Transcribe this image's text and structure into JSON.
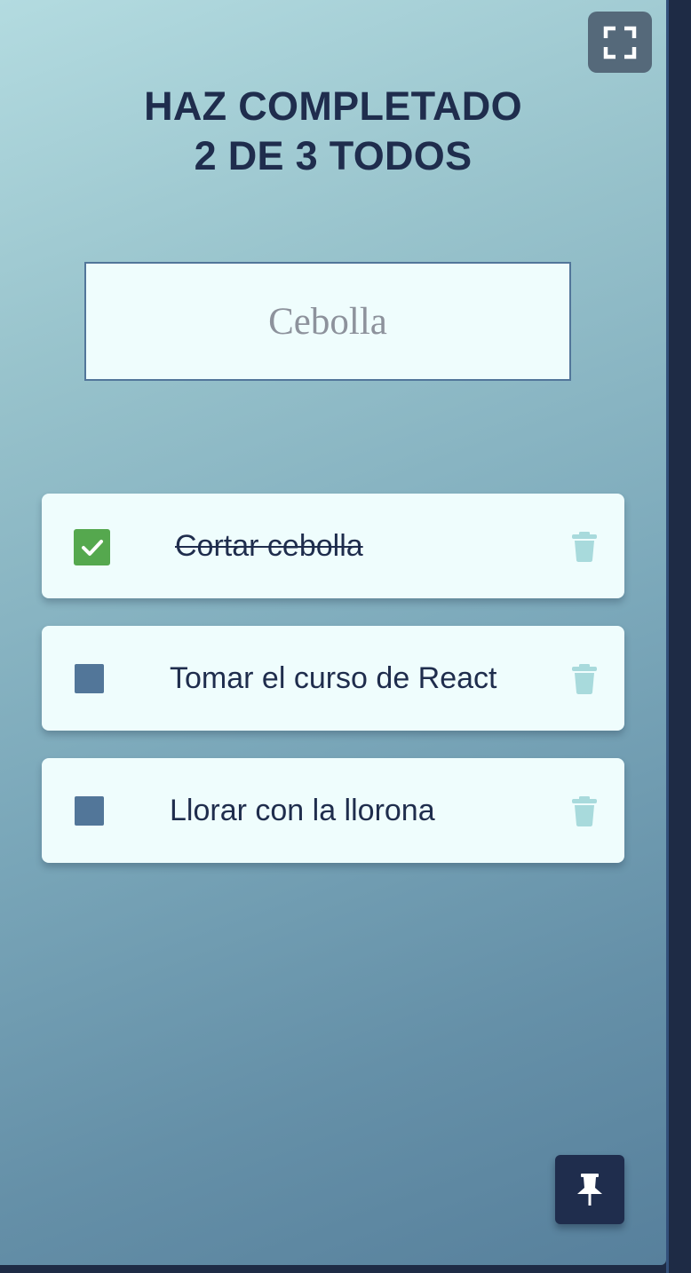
{
  "header": {
    "title_line1": "HAZ COMPLETADO",
    "title_line2": "2 DE 3 TODOS",
    "completed_count": 2,
    "total_count": 3
  },
  "search": {
    "placeholder": "Cebolla",
    "value": ""
  },
  "todos": [
    {
      "text": "Cortar cebolla",
      "completed": true
    },
    {
      "text": "Tomar el curso de React",
      "completed": false
    },
    {
      "text": "Llorar con la llorona",
      "completed": false
    }
  ],
  "icons": {
    "fullscreen": "fullscreen-icon",
    "check": "check-icon",
    "delete": "trash-icon",
    "pin": "pin-icon"
  },
  "colors": {
    "title_text": "#1f2d4d",
    "checkbox_unchecked": "#527699",
    "checkbox_checked": "#55a84e",
    "trash_icon": "#a8dadc",
    "pin_button": "#1f2d4d"
  }
}
